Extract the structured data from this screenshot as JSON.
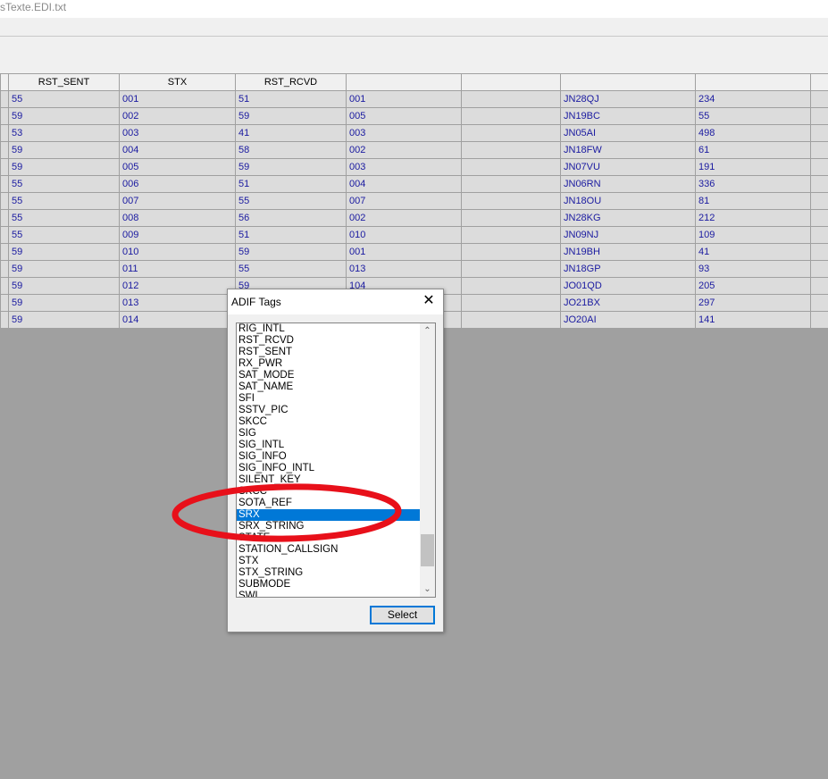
{
  "window": {
    "title": "sTexte.EDI.txt"
  },
  "table": {
    "headers": [
      "",
      "RST_SENT",
      "STX",
      "RST_RCVD",
      "",
      "",
      "",
      "",
      ""
    ],
    "rows": [
      [
        "",
        "55",
        "001",
        "51",
        "001",
        "",
        "JN28QJ",
        "234",
        ""
      ],
      [
        "",
        "59",
        "002",
        "59",
        "005",
        "",
        "JN19BC",
        "55",
        ""
      ],
      [
        "",
        "53",
        "003",
        "41",
        "003",
        "",
        "JN05AI",
        "498",
        ""
      ],
      [
        "",
        "59",
        "004",
        "58",
        "002",
        "",
        "JN18FW",
        "61",
        ""
      ],
      [
        "",
        "59",
        "005",
        "59",
        "003",
        "",
        "JN07VU",
        "191",
        ""
      ],
      [
        "",
        "55",
        "006",
        "51",
        "004",
        "",
        "JN06RN",
        "336",
        ""
      ],
      [
        "",
        "55",
        "007",
        "55",
        "007",
        "",
        "JN18OU",
        "81",
        ""
      ],
      [
        "",
        "55",
        "008",
        "56",
        "002",
        "",
        "JN28KG",
        "212",
        ""
      ],
      [
        "",
        "55",
        "009",
        "51",
        "010",
        "",
        "JN09NJ",
        "109",
        ""
      ],
      [
        "",
        "59",
        "010",
        "59",
        "001",
        "",
        "JN19BH",
        "41",
        ""
      ],
      [
        "",
        "59",
        "011",
        "55",
        "013",
        "",
        "JN18GP",
        "93",
        ""
      ],
      [
        "",
        "59",
        "012",
        "59",
        "104",
        "",
        "JO01QD",
        "205",
        ""
      ],
      [
        "",
        "59",
        "013",
        "",
        "",
        "",
        "JO21BX",
        "297",
        ""
      ],
      [
        "",
        "59",
        "014",
        "",
        "",
        "",
        "JO20AI",
        "141",
        ""
      ]
    ]
  },
  "dialog": {
    "title": "ADIF Tags",
    "close_glyph": "✕",
    "items": [
      "RIG_INTL",
      "RST_RCVD",
      "RST_SENT",
      "RX_PWR",
      "SAT_MODE",
      "SAT_NAME",
      "SFI",
      "SSTV_PIC",
      "SKCC",
      "SIG",
      "SIG_INTL",
      "SIG_INFO",
      "SIG_INFO_INTL",
      "SILENT_KEY",
      "SKCC",
      "SOTA_REF",
      "SRX",
      "SRX_STRING",
      "STATE",
      "STATION_CALLSIGN",
      "STX",
      "STX_STRING",
      "SUBMODE",
      "SWL"
    ],
    "selected_item": "SRX",
    "select_label": "Select",
    "scroll_up_glyph": "⌃",
    "scroll_down_glyph": "⌄"
  },
  "colors": {
    "selection": "#0078d7",
    "annotation": "#e8101a",
    "cell_text": "#1a1aa0"
  }
}
